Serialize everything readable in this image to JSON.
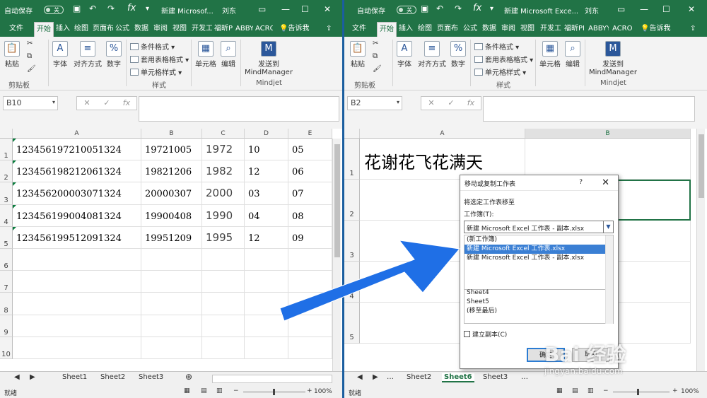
{
  "left_window": {
    "autosave": "自动保存",
    "autosave_state": "关",
    "title": "新建 Microsof...",
    "user": "刘东",
    "tabs": [
      "文件",
      "开始",
      "插入",
      "绘图",
      "页面布",
      "公式",
      "数据",
      "审阅",
      "视图",
      "开发工",
      "福昕P",
      "ABBYY",
      "ACRO",
      "告诉我"
    ],
    "active_tab": "开始",
    "ribbon": {
      "paste": "粘贴",
      "font": "字体",
      "align": "对齐方式",
      "number": "数字",
      "cond_format": "条件格式",
      "table_format": "套用表格格式",
      "cell_style": "单元格样式",
      "cells": "单元格",
      "edit": "编辑",
      "mindmanager": "发送到",
      "mindmanager2": "MindManager",
      "group_clipboard": "剪贴板",
      "group_style": "样式",
      "group_mindjet": "Mindjet"
    },
    "name_box": "B10",
    "columns": [
      "A",
      "B",
      "C",
      "D",
      "E"
    ],
    "rows": [
      "1",
      "2",
      "3",
      "4",
      "5",
      "6",
      "7",
      "8",
      "9",
      "10"
    ],
    "data": [
      [
        "123456197210051324",
        "19721005",
        "1972",
        "10",
        "05"
      ],
      [
        "123456198212061324",
        "19821206",
        "1982",
        "12",
        "06"
      ],
      [
        "123456200003071324",
        "20000307",
        "2000",
        "03",
        "07"
      ],
      [
        "123456199004081324",
        "19900408",
        "1990",
        "04",
        "08"
      ],
      [
        "123456199512091324",
        "19951209",
        "1995",
        "12",
        "09"
      ]
    ],
    "sheets": [
      "Sheet1",
      "Sheet2",
      "Sheet3"
    ],
    "status": "就绪",
    "zoom": "100%"
  },
  "right_window": {
    "autosave": "自动保存",
    "autosave_state": "关",
    "title": "新建 Microsoft Exce...",
    "user": "刘东",
    "tabs": [
      "文件",
      "开始",
      "插入",
      "绘图",
      "页面布",
      "公式",
      "数据",
      "审阅",
      "视图",
      "开发工",
      "福昕PI",
      "ABBYY",
      "ACROI",
      "告诉我"
    ],
    "active_tab": "开始",
    "name_box": "B2",
    "columns": [
      "A",
      "B"
    ],
    "rows": [
      "1",
      "2",
      "3",
      "4",
      "5"
    ],
    "cell_a1": "花谢花飞花满天",
    "sheets": [
      "Sheet2",
      "Sheet6",
      "Sheet3"
    ],
    "active_sheet": "Sheet6",
    "status": "就绪",
    "zoom": "100%"
  },
  "dialog": {
    "title": "移动或复制工作表",
    "help": "?",
    "close": "✕",
    "label_move": "将选定工作表移至",
    "label_book": "工作簿(T):",
    "selected_book": "新建 Microsoft Excel 工作表 - 副本.xlsx",
    "book_options": [
      "(新工作簿)",
      "新建 Microsoft Excel 工作表.xlsx",
      "新建 Microsoft Excel 工作表 - 副本.xlsx"
    ],
    "highlighted_option": "新建 Microsoft Excel 工作表.xlsx",
    "sheet_list": [
      "Sheet4",
      "Sheet5",
      "(移至最后)"
    ],
    "copy_label": "建立副本(C)",
    "ok": "确定",
    "cancel": "取消"
  },
  "watermark": {
    "brand": "Bai 经验",
    "url": "jingyan.baidu.com"
  },
  "colors": {
    "excel_green": "#217346",
    "arrow_blue": "#1f6fe6",
    "selection_blue": "#3a7fd4"
  }
}
